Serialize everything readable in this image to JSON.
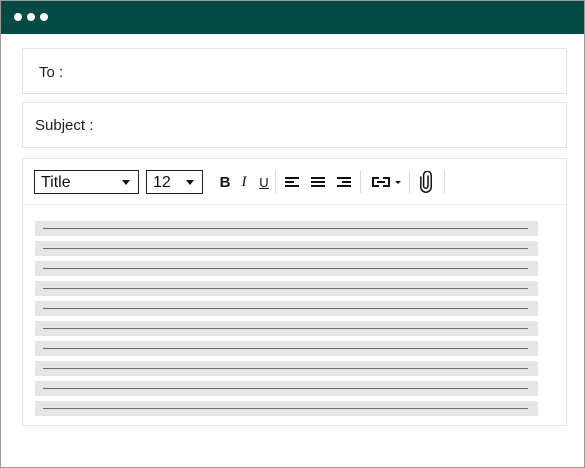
{
  "window": {
    "titlebar_color": "#044b46",
    "controls": [
      "window-dot-icon",
      "window-dot-icon",
      "window-dot-icon"
    ]
  },
  "compose": {
    "to_label": "To :",
    "subject_label": "Subject :",
    "to_value": "",
    "subject_value": ""
  },
  "toolbar": {
    "font_style": "Title",
    "font_size": "12",
    "bold_label": "B",
    "italic_label": "I",
    "underline_label": "U",
    "icons": [
      "align-left-icon",
      "align-center-icon",
      "align-right-icon",
      "link-icon",
      "paperclip-icon"
    ]
  },
  "body": {
    "placeholder_line_count": 10
  }
}
